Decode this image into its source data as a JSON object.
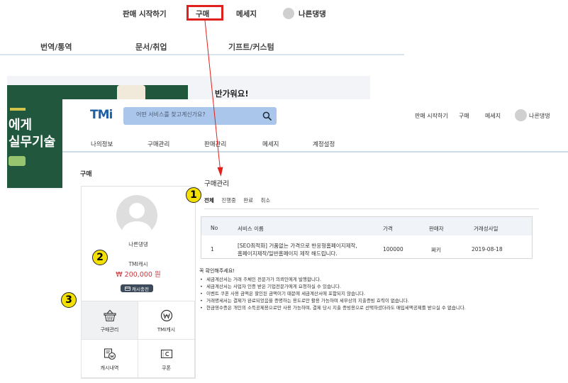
{
  "background_page": {
    "nav": {
      "start_selling": "판매 시작하기",
      "buy": "구매",
      "messages": "메세지",
      "username": "나른댕댕"
    },
    "categories": [
      "번역/통역",
      "문서/취업",
      "기프트/커스텀"
    ],
    "banner": {
      "line1": "에게",
      "line2": "실무기술"
    },
    "welcome": "반가워요!"
  },
  "header": {
    "logo": "TMi",
    "search_placeholder": "어떤 서비스를 찾고계신가요?",
    "nav": {
      "start_selling": "판매 시작하기",
      "buy": "구매",
      "messages": "메세지",
      "username": "나른댕댕"
    }
  },
  "tabs": [
    "나의정보",
    "구매관리",
    "판매관리",
    "메세지",
    "계정설정"
  ],
  "sidebar": {
    "section_title": "구매",
    "profile_name": "나른댕댕",
    "cash_label": "TMI캐시",
    "cash_amount": "₩ 200,000 원",
    "charge_button": "캐시충전",
    "menu": [
      "구매관리",
      "TMI캐시",
      "캐시내역",
      "쿠폰"
    ]
  },
  "content": {
    "title": "구매관리",
    "status_tabs": [
      "전체",
      "진행중",
      "완료",
      "취소"
    ],
    "table": {
      "headers": [
        "No",
        "서비스 이름",
        "가격",
        "판매자",
        "거래성사일"
      ],
      "rows": [
        {
          "no": "1",
          "service_line1": "[SEO최적화] 거품없는 가격으로 반응형홈페이지제작,",
          "service_line2": "홈페이지제작/일반홈페이지 제작 해드립니다.",
          "price": "100000",
          "seller": "쩌키",
          "date": "2019-08-18"
        }
      ]
    },
    "notice_title": "꼭 확인해주세요!",
    "notices": [
      "세금계산서는 거래 주체인 전문가가 의뢰인에게 발행합니다.",
      "세금계산서는 사업자 인증 받은 기업전문가에게 요청하실 수 있습니다.",
      "이벤트 쿠폰 사용 금액은 할인된 금액이기 때문에 세금계산서에 포함되지 않습니다.",
      "거래명세서는 결제가 완료되었음을 증명하는 용도로만 활용 가능하며 세무상의 지출증빙 효력이 없습니다.",
      "현금영수증은 개인의 소득공제용으로만 사용 가능하며, 결제 당시 지출 증빙용으로 선택하셨더라도 매입세액공제를 받으실 수 없습니다."
    ]
  },
  "annotations": [
    "1",
    "2",
    "3"
  ],
  "colors": {
    "annotation_red": "#e0201c",
    "marker_yellow": "#f3e000",
    "search_bg": "#aac7eb",
    "cash_red": "#c9363a",
    "logo_blue": "#1f5fa8"
  }
}
